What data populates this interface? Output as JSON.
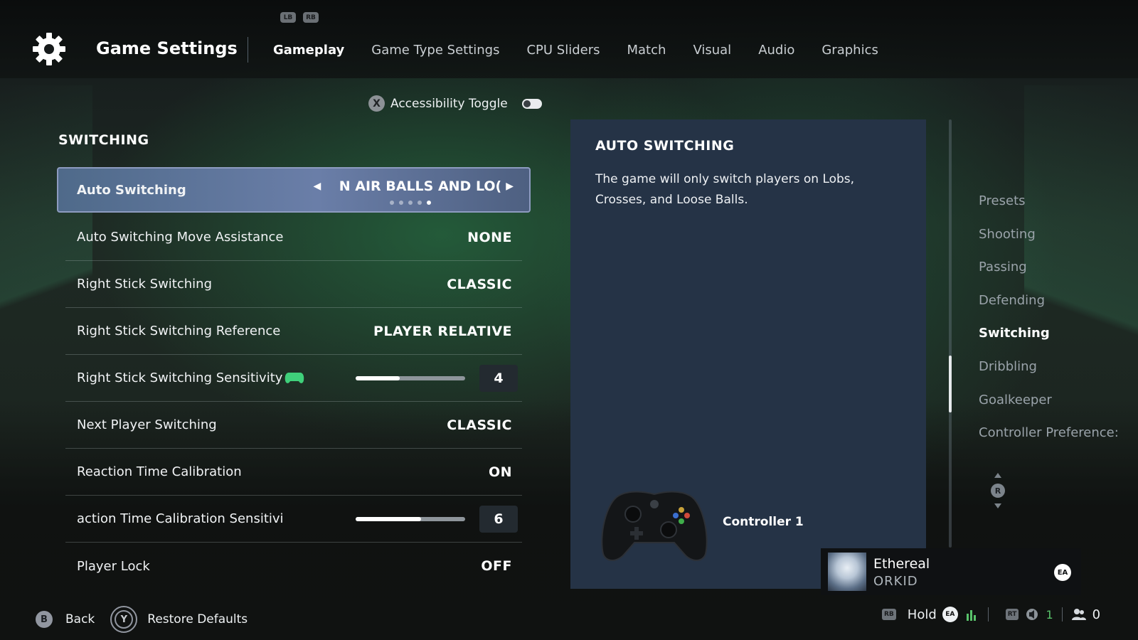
{
  "header": {
    "shoulder_left": "LB",
    "shoulder_right": "RB",
    "title": "Game Settings",
    "tabs": [
      {
        "label": "Gameplay",
        "active": true
      },
      {
        "label": "Game Type Settings",
        "active": false
      },
      {
        "label": "CPU Sliders",
        "active": false
      },
      {
        "label": "Match",
        "active": false
      },
      {
        "label": "Visual",
        "active": false
      },
      {
        "label": "Audio",
        "active": false
      },
      {
        "label": "Graphics",
        "active": false
      }
    ]
  },
  "accessibility": {
    "button": "X",
    "label": "Accessibility Toggle",
    "enabled": false
  },
  "section": {
    "title": "SWITCHING"
  },
  "settings": {
    "auto_switching": {
      "label": "Auto Switching",
      "value": "N AIR BALLS AND LO(",
      "option_count": 5,
      "option_index": 4
    },
    "move_assistance": {
      "label": "Auto Switching Move Assistance",
      "value": "NONE"
    },
    "rs_switching": {
      "label": "Right Stick Switching",
      "value": "CLASSIC"
    },
    "rs_reference": {
      "label": "Right Stick Switching Reference",
      "value": "PLAYER RELATIVE"
    },
    "rs_sensitivity": {
      "label": "Right Stick Switching Sensitivity",
      "value": "4",
      "level": 0.4
    },
    "next_player": {
      "label": "Next Player Switching",
      "value": "CLASSIC"
    },
    "reaction_cal": {
      "label": "Reaction Time Calibration",
      "value": "ON"
    },
    "reaction_sens": {
      "label": "action Time Calibration Sensitivi",
      "value": "6",
      "level": 0.6
    },
    "player_lock": {
      "label": "Player Lock",
      "value": "OFF"
    }
  },
  "description": {
    "title": "AUTO SWITCHING",
    "text": "The game will only switch players on Lobs, Crosses, and Loose Balls.",
    "controller_label": "Controller 1"
  },
  "categories": [
    {
      "label": "Presets",
      "active": false
    },
    {
      "label": "Shooting",
      "active": false
    },
    {
      "label": "Passing",
      "active": false
    },
    {
      "label": "Defending",
      "active": false
    },
    {
      "label": "Switching",
      "active": true
    },
    {
      "label": "Dribbling",
      "active": false
    },
    {
      "label": "Goalkeeper",
      "active": false
    },
    {
      "label": "Controller Preference:",
      "active": false
    }
  ],
  "rail_stick_label": "R",
  "footer": {
    "back_button": "B",
    "back_label": "Back",
    "restore_button": "Y",
    "restore_label": "Restore Defaults"
  },
  "friend_toast": {
    "name": "Ethereal",
    "subtitle": "ORKID",
    "badge": "EA"
  },
  "status": {
    "rb": "RB",
    "hold": "Hold",
    "ea": "EA",
    "rt": "RT",
    "voice_count": "1",
    "party_count": "0"
  },
  "colors": {
    "selected_row": "#6a7ea8",
    "panel": "#253346",
    "accent_green": "#58c26a"
  }
}
